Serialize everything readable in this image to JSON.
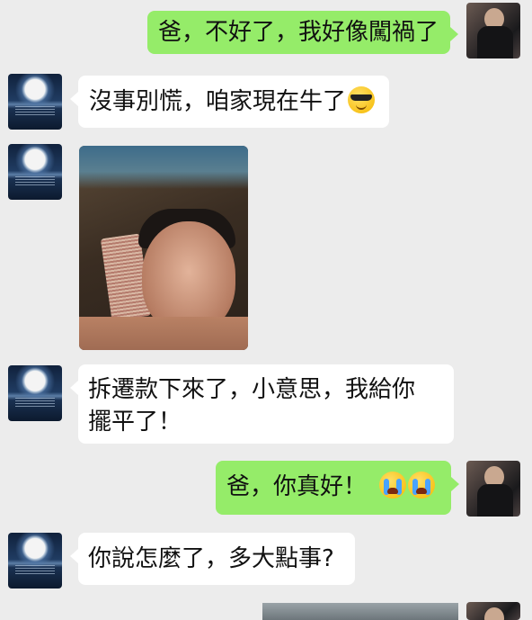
{
  "messages": [
    {
      "id": "m1",
      "sender": "son",
      "text": "爸，不好了，我好像闖禍了"
    },
    {
      "id": "m2",
      "sender": "dad",
      "text": "沒事別慌，咱家現在牛了",
      "emoji": "sunglasses-emoji"
    },
    {
      "id": "m3",
      "sender": "dad",
      "type": "image",
      "image_desc_icon": "photo-icon"
    },
    {
      "id": "m4",
      "sender": "dad",
      "line1": "拆遷款下來了，小意思，我給你",
      "line2": "擺平了！"
    },
    {
      "id": "m5",
      "sender": "son",
      "text": "爸，你真好！",
      "emoji": "crying-emoji"
    },
    {
      "id": "m6",
      "sender": "dad",
      "text": "你說怎麼了，多大點事?"
    }
  ],
  "colors": {
    "background": "#ececec",
    "incoming_bubble": "#ffffff",
    "outgoing_bubble": "#95ec69"
  }
}
